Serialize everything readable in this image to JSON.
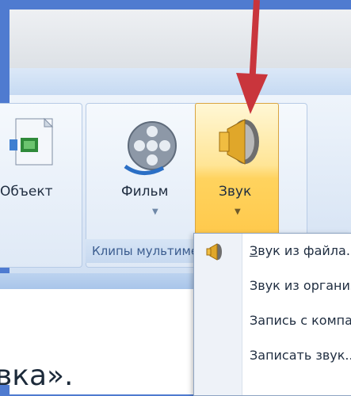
{
  "ribbon": {
    "object_label": "Объект",
    "movie_label": "Фильм",
    "sound_label": "Звук",
    "group_label": "Клипы мультимедиа"
  },
  "sound_menu": {
    "items": [
      {
        "accelerator": "З",
        "rest": "вук из файла..."
      },
      {
        "accelerator": "",
        "rest": "Звук из организатора клипов..."
      },
      {
        "accelerator": "",
        "rest": "Запись с компакт-диска..."
      },
      {
        "accelerator": "",
        "rest": "Записать звук..."
      }
    ]
  },
  "slide": {
    "text": "вка»."
  },
  "colors": {
    "frame": "#4f7bd0",
    "highlight": "#ffd35e",
    "arrow": "#c9353c"
  }
}
